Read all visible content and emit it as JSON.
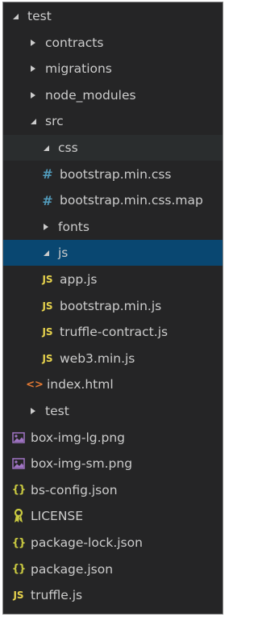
{
  "explorer": {
    "items": [
      {
        "label": "test",
        "type": "folder-open",
        "depth": 0
      },
      {
        "label": "contracts",
        "type": "folder-closed",
        "depth": 1
      },
      {
        "label": "migrations",
        "type": "folder-closed",
        "depth": 1
      },
      {
        "label": "node_modules",
        "type": "folder-closed",
        "depth": 1
      },
      {
        "label": "src",
        "type": "folder-open",
        "depth": 1
      },
      {
        "label": "css",
        "type": "folder-open",
        "depth": 2,
        "state": "hover"
      },
      {
        "label": "bootstrap.min.css",
        "type": "css-file",
        "depth": 3
      },
      {
        "label": "bootstrap.min.css.map",
        "type": "css-file",
        "depth": 3
      },
      {
        "label": "fonts",
        "type": "folder-closed",
        "depth": 2
      },
      {
        "label": "js",
        "type": "folder-open",
        "depth": 2,
        "state": "selected"
      },
      {
        "label": "app.js",
        "type": "js-file",
        "depth": 3
      },
      {
        "label": "bootstrap.min.js",
        "type": "js-file",
        "depth": 3
      },
      {
        "label": "truffle-contract.js",
        "type": "js-file",
        "depth": 3
      },
      {
        "label": "web3.min.js",
        "type": "js-file",
        "depth": 3
      },
      {
        "label": "index.html",
        "type": "html-file",
        "depth": 2
      },
      {
        "label": "test",
        "type": "folder-closed",
        "depth": 1
      },
      {
        "label": "box-img-lg.png",
        "type": "image-file",
        "depth": 1
      },
      {
        "label": "box-img-sm.png",
        "type": "image-file",
        "depth": 1
      },
      {
        "label": "bs-config.json",
        "type": "json-file",
        "depth": 1
      },
      {
        "label": "LICENSE",
        "type": "license-file",
        "depth": 1
      },
      {
        "label": "package-lock.json",
        "type": "json-file",
        "depth": 1
      },
      {
        "label": "package.json",
        "type": "json-file",
        "depth": 1
      },
      {
        "label": "truffle.js",
        "type": "js-file",
        "depth": 1
      }
    ],
    "icons": {
      "js-file": "JS",
      "css-file": "#",
      "html-file": "<>",
      "json-file": "{}"
    },
    "colors": {
      "background": "#252526",
      "selected": "#094771",
      "hover": "#2a2d2e",
      "text": "#cccccc",
      "js": "#e8d44d",
      "css": "#519aba",
      "html": "#e37933",
      "json": "#cbcb41"
    }
  }
}
